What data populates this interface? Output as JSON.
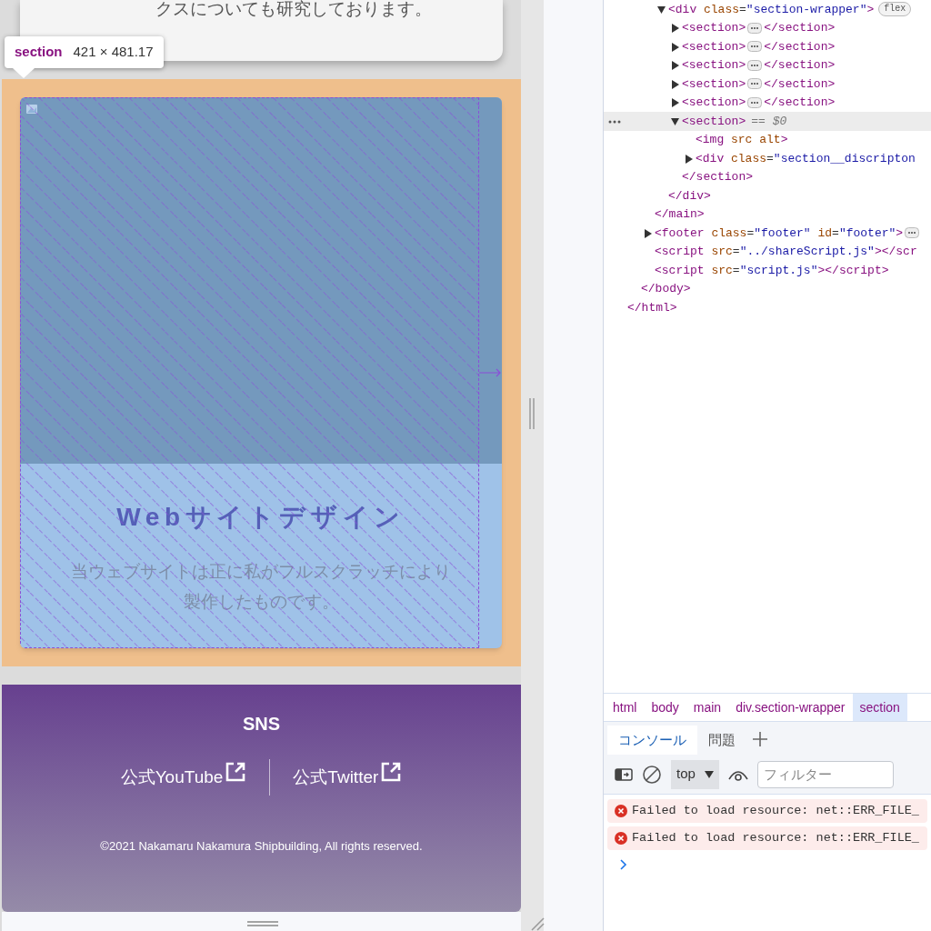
{
  "page": {
    "top_card": {
      "text": "クスについても研究しております。"
    },
    "inspector_tooltip": {
      "tag": "section",
      "size": "421 × 481.17"
    },
    "section_card": {
      "title": "Webサイトデザイン",
      "description": "当ウェブサイトは正に私がフルスクラッチにより製作したものです。"
    },
    "footer": {
      "heading": "SNS",
      "links": [
        {
          "label": "公式YouTube"
        },
        {
          "label": "公式Twitter"
        }
      ],
      "copyright": "©2021 Nakamaru Nakamura Shipbuilding, All rights reserved."
    }
  },
  "devtools": {
    "dom_tree": [
      {
        "closing": "</html>",
        "children": [
          {
            "closing": "</body>",
            "children": [
              {
                "closing": "</main>",
                "children": [
                  {
                    "text": "<div class=\"section-wrapper\">",
                    "badge": "flex",
                    "expanded": true,
                    "selected": false,
                    "closing": "</div>",
                    "children": [
                      {
                        "text": "<section>",
                        "expanded": false,
                        "more": true,
                        "selected": false,
                        "closing": "</section>"
                      },
                      {
                        "text": "<section>",
                        "expanded": false,
                        "more": true,
                        "selected": false,
                        "closing": "</section>"
                      },
                      {
                        "text": "<section>",
                        "expanded": false,
                        "more": true,
                        "selected": false,
                        "closing": "</section>"
                      },
                      {
                        "text": "<section>",
                        "expanded": false,
                        "more": true,
                        "selected": false,
                        "closing": "</section>"
                      },
                      {
                        "text": "<section>",
                        "expanded": false,
                        "more": true,
                        "selected": false,
                        "closing": "</section>"
                      },
                      {
                        "text": "<section>",
                        "expanded": true,
                        "selected": true,
                        "suffix": "== $0",
                        "closing": "</section>",
                        "children": [
                          {
                            "text": "<img src alt>",
                            "selected": false
                          },
                          {
                            "text": "<div class=\"section__discripton",
                            "expanded": false,
                            "selected": false
                          }
                        ]
                      }
                    ]
                  }
                ]
              },
              {
                "text": "<footer class=\"footer\" id=\"footer\">",
                "expanded": false,
                "more": true,
                "selected": false
              },
              {
                "text": "<script src=\"../shareScript.js\"></scr",
                "selected": false
              },
              {
                "text": "<script src=\"script.js\"></script>",
                "selected": false
              }
            ]
          }
        ]
      }
    ],
    "breadcrumbs": [
      {
        "label": "html",
        "selected": false
      },
      {
        "label": "body",
        "selected": false
      },
      {
        "label": "main",
        "selected": false
      },
      {
        "label": "div.section-wrapper",
        "selected": false
      },
      {
        "label": "section",
        "selected": true
      }
    ],
    "drawer_tabs": [
      {
        "label": "コンソール",
        "selected": true
      },
      {
        "label": "問題",
        "selected": false
      }
    ],
    "console_toolbar": {
      "context": "top",
      "filter_placeholder": "フィルター"
    },
    "messages": [
      {
        "kind": "error",
        "text": "Failed to load resource: net::ERR_FILE_"
      },
      {
        "kind": "error",
        "text": "Failed to load resource: net::ERR_FILE_"
      }
    ]
  }
}
